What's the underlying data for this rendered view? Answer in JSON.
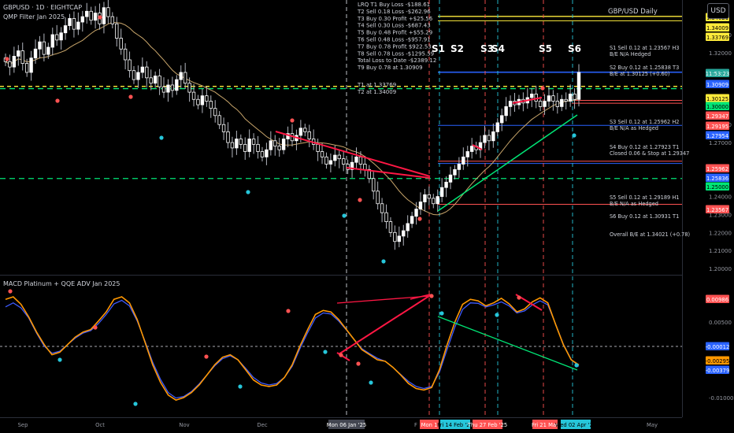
{
  "header": {
    "symbol_line": "GBPUSD · 1D · EIGHTCAP",
    "indicator_top": "QMP Filter Jan 2025",
    "indicator_bottom": "MACD Platinum + QQE ADV Jan 2025",
    "chart_title": "GBP/USD Daily",
    "currency_button": "USD"
  },
  "trade_log": [
    "LRQ T1 Buy Loss -$188.61",
    "T2 Sell 0.18 Loss -$262.96",
    "T3 Buy 0.30 Profit +$25.56",
    "T4 Sell 0.30 Loss -$687.43",
    "T5 Buy 0.48 Profit +$55.29",
    "T6 Sell 0.48 Loss -$957.91",
    "T7 Buy 0.78 Profit $922.53",
    "T8 Sell 0.78 Loss -$1295.59",
    "Total Loss to Date -$2389.12",
    "T9 Buy 0.78 at 1.30909",
    "",
    "T1 at 1.33769",
    "T2 at 1.34009"
  ],
  "right_notes": [
    "S1 Sell 0.12 at 1.23567 H3",
    "B/E N/A Hedged",
    "S2 Buy 0.12 at 1.25838 T3",
    "B/E at 1.30125 (+0.60)",
    "S3 Sell 0.12 at 1.25962 H2",
    "B/E N/A as Hedged",
    "S4 Buy 0.12 at 1.27923 T1",
    "Closed 0.06 & Stop at 1.29347",
    "S5 Sell 0.12 at 1.29189 H1",
    "B/E N/A as Hedged",
    "S6 Buy 0.12 at 1.30931 T1",
    "Overall B/E at 1.34021 (+0.78)"
  ],
  "signal_labels": [
    "S1",
    "S2",
    "S3",
    "S4",
    "S5",
    "S6"
  ],
  "x_axis_labels": [
    "Sep",
    "Oct",
    "Nov",
    "Dec",
    "Mon 06 Jan '25",
    "F",
    "Mon 1",
    "Fri 14 Feb '25",
    "Thu 27 Feb '25",
    "Fri 21 Mar",
    "Wed 02 Apr '25",
    "May"
  ],
  "price_axis": {
    "ticks": [
      "1.33000",
      "1.32000",
      "1.28000",
      "1.27000",
      "1.24000",
      "1.23000",
      "1.22000",
      "1.21000",
      "1.20000"
    ],
    "tags": [
      {
        "text": "1.34021",
        "color": "#ffeb3b"
      },
      {
        "text": "1.34009",
        "color": "#ffeb3b"
      },
      {
        "text": "1.33769",
        "color": "#ffeb3b"
      },
      {
        "text": "11:53:23",
        "color": "#26a69a"
      },
      {
        "text": "1.30909",
        "color": "#2962ff"
      },
      {
        "text": "1.30125",
        "color": "#ffeb3b"
      },
      {
        "text": "1.30000",
        "color": "#00e676"
      },
      {
        "text": "1.29347",
        "color": "#ff5252"
      },
      {
        "text": "1.29195",
        "color": "#ff5252"
      },
      {
        "text": "1.27954",
        "color": "#2962ff"
      },
      {
        "text": "1.25962",
        "color": "#ff5252"
      },
      {
        "text": "1.25836",
        "color": "#2962ff"
      },
      {
        "text": "1.25000",
        "color": "#00e676"
      },
      {
        "text": "1.23567",
        "color": "#ff5252"
      }
    ]
  },
  "macd_axis": {
    "ticks": [
      "0.00500",
      "-0.01000"
    ],
    "tags": [
      {
        "text": "0.00986",
        "color": "#ff5252"
      },
      {
        "text": "-0.00012",
        "color": "#2962ff"
      },
      {
        "text": "-0.00295",
        "color": "#ff9800"
      },
      {
        "text": "-0.00379",
        "color": "#2962ff"
      }
    ]
  },
  "chart_data": {
    "type": "candlestick",
    "title": "GBP/USD Daily",
    "instrument": "GBPUSD",
    "timeframe": "1D",
    "ylim": [
      1.2,
      1.341
    ],
    "x_range": [
      "Sep 2024",
      "May 2025"
    ],
    "series": [
      {
        "name": "GBPUSD",
        "close": [
          1.315,
          1.312,
          1.318,
          1.321,
          1.314,
          1.309,
          1.317,
          1.322,
          1.326,
          1.319,
          1.323,
          1.33,
          1.327,
          1.331,
          1.335,
          1.339,
          1.333,
          1.337,
          1.34,
          1.343,
          1.338,
          1.342,
          1.336,
          1.345,
          1.34,
          1.336,
          1.328,
          1.322,
          1.316,
          1.31,
          1.305,
          1.309,
          1.312,
          1.306,
          1.303,
          1.307,
          1.301,
          1.298,
          1.302,
          1.299,
          1.305,
          1.309,
          1.303,
          1.298,
          1.294,
          1.291,
          1.296,
          1.293,
          1.289,
          1.285,
          1.28,
          1.276,
          1.27,
          1.267,
          1.272,
          1.269,
          1.265,
          1.272,
          1.269,
          1.265,
          1.262,
          1.266,
          1.271,
          1.268,
          1.266,
          1.272,
          1.275,
          1.271,
          1.274,
          1.278,
          1.276,
          1.272,
          1.269,
          1.265,
          1.262,
          1.258,
          1.26,
          1.263,
          1.261,
          1.258,
          1.255,
          1.259,
          1.262,
          1.258,
          1.255,
          1.25,
          1.243,
          1.236,
          1.231,
          1.226,
          1.22,
          1.215,
          1.218,
          1.221,
          1.225,
          1.229,
          1.233,
          1.237,
          1.241,
          1.239,
          1.236,
          1.24,
          1.245,
          1.248,
          1.252,
          1.255,
          1.258,
          1.262,
          1.265,
          1.268,
          1.266,
          1.27,
          1.274,
          1.271,
          1.276,
          1.281,
          1.285,
          1.29,
          1.293,
          1.291,
          1.294,
          1.292,
          1.295,
          1.297,
          1.293,
          1.29,
          1.293,
          1.296,
          1.293,
          1.29,
          1.294,
          1.293,
          1.297,
          1.294,
          1.309
        ]
      }
    ],
    "levels": [
      {
        "name": "Overall B/E",
        "value": 1.34021,
        "color": "#ffeb3b"
      },
      {
        "name": "T2",
        "value": 1.34009,
        "color": "#ffeb3b"
      },
      {
        "name": "T1",
        "value": 1.33769,
        "color": "#ffeb3b"
      },
      {
        "name": "T9 Buy",
        "value": 1.30909,
        "color": "#2962ff"
      },
      {
        "name": "S2 B/E",
        "value": 1.30125,
        "color": "#ffeb3b"
      },
      {
        "name": "Green 1.30",
        "value": 1.3,
        "color": "#00e676"
      },
      {
        "name": "S4 Stop",
        "value": 1.29347,
        "color": "#ff5252"
      },
      {
        "name": "S5 Sell",
        "value": 1.29189,
        "color": "#ff5252"
      },
      {
        "name": "S4 Buy",
        "value": 1.27954,
        "color": "#2962ff"
      },
      {
        "name": "S3 Sell",
        "value": 1.25962,
        "color": "#ff5252"
      },
      {
        "name": "S2 Buy",
        "value": 1.25836,
        "color": "#2962ff"
      },
      {
        "name": "Green 1.25",
        "value": 1.25,
        "color": "#00e676"
      },
      {
        "name": "S1 Sell",
        "value": 1.23567,
        "color": "#ff5252"
      }
    ],
    "macd": {
      "name": "MACD Platinum + QQE ADV Jan 2025",
      "ylim": [
        -0.011,
        0.011
      ],
      "values": [
        0.0095,
        0.01,
        0.0085,
        0.006,
        0.003,
        0.0005,
        -0.0015,
        -0.001,
        0.0005,
        0.002,
        0.003,
        0.0035,
        0.0052,
        0.007,
        0.0095,
        0.01,
        0.0088,
        0.0055,
        0.001,
        -0.0035,
        -0.007,
        -0.0095,
        -0.0105,
        -0.01,
        -0.009,
        -0.0075,
        -0.0055,
        -0.0035,
        -0.002,
        -0.0015,
        -0.0025,
        -0.0045,
        -0.0065,
        -0.0075,
        -0.0078,
        -0.0075,
        -0.006,
        -0.0035,
        0.0002,
        0.0035,
        0.0065,
        0.0073,
        0.007,
        0.0055,
        0.0035,
        0.0015,
        -0.0005,
        -0.0015,
        -0.0025,
        -0.0028,
        -0.004,
        -0.0055,
        -0.0072,
        -0.0082,
        -0.0085,
        -0.008,
        -0.0045,
        0.0005,
        0.005,
        0.0085,
        0.0095,
        0.0092,
        0.0082,
        0.0088,
        0.0097,
        0.0086,
        0.007,
        0.0076,
        0.009,
        0.0098,
        0.0088,
        0.0045,
        0.0005,
        -0.0025,
        -0.0035
      ],
      "signal_line": [
        0.008,
        0.0088,
        0.0078,
        0.0058,
        0.0028,
        0.0002,
        -0.0012,
        -0.0008,
        0.0005,
        0.0018,
        0.0028,
        0.0033,
        0.0047,
        0.0065,
        0.0086,
        0.0093,
        0.0082,
        0.0052,
        0.0012,
        -0.003,
        -0.0064,
        -0.009,
        -0.0101,
        -0.0098,
        -0.0088,
        -0.0073,
        -0.0055,
        -0.0037,
        -0.0023,
        -0.0017,
        -0.0025,
        -0.0042,
        -0.006,
        -0.0071,
        -0.0075,
        -0.0072,
        -0.006,
        -0.0038,
        -0.0003,
        0.0029,
        0.0058,
        0.0068,
        0.0066,
        0.0052,
        0.0034,
        0.0015,
        -0.0003,
        -0.0013,
        -0.0022,
        -0.0028,
        -0.004,
        -0.0054,
        -0.0068,
        -0.0078,
        -0.0082,
        -0.0078,
        -0.005,
        -0.0004,
        0.004,
        0.0075,
        0.0088,
        0.0087,
        0.008,
        0.0084,
        0.009,
        0.0082,
        0.0068,
        0.0072,
        0.0084,
        0.0092,
        0.0084,
        0.0046,
        0.0006,
        -0.0024,
        -0.0038
      ]
    }
  }
}
